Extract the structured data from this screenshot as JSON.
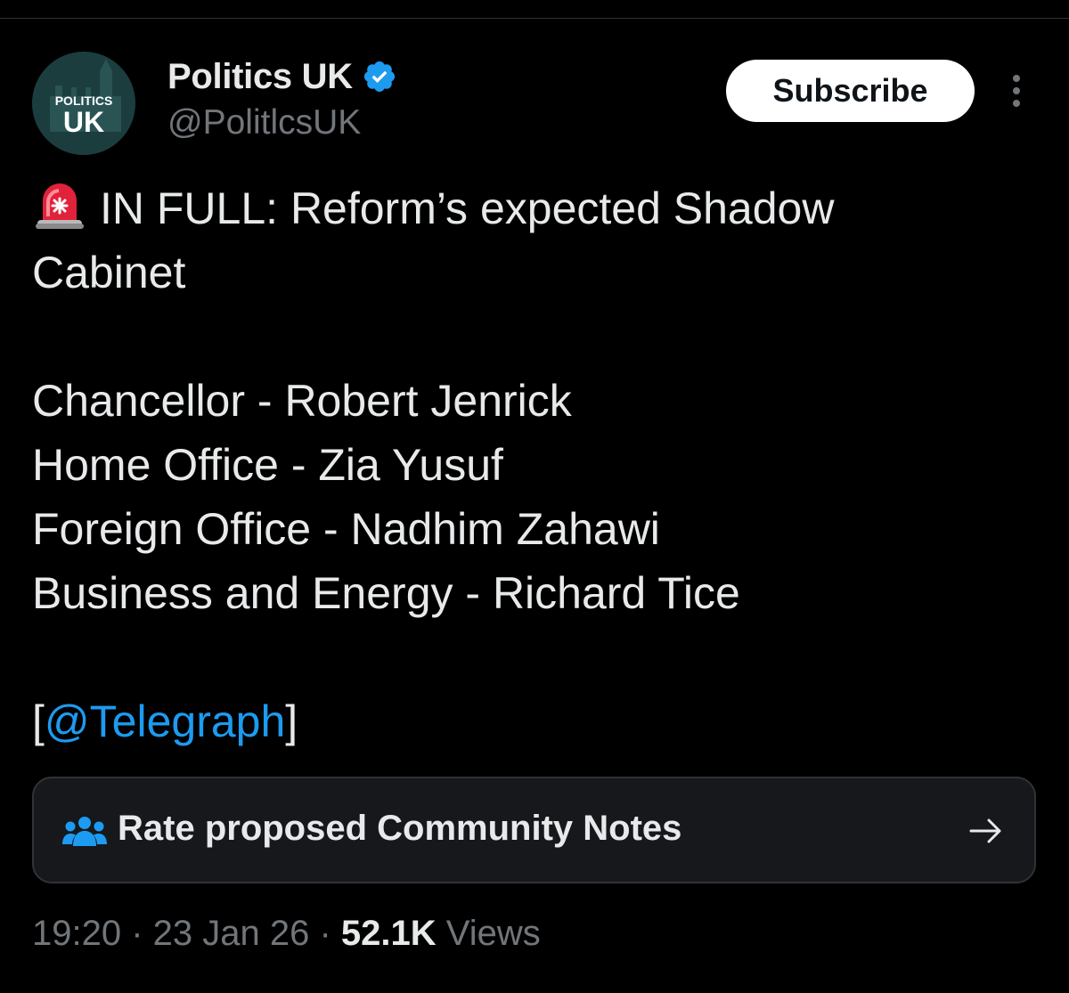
{
  "post": {
    "display_name": "Politics UK",
    "handle": "@PolitlcsUK",
    "avatar_text_top": "POLITICS",
    "avatar_text_bottom": "UK",
    "verified": true,
    "subscribe_label": "Subscribe",
    "text_lines": [
      "IN FULL: Reform’s expected Shadow",
      "Cabinet",
      "",
      "Chancellor - Robert Jenrick",
      "Home Office - Zia Yusuf",
      "Foreign Office - Nadhim Zahawi",
      "Business and Energy - Richard Tice",
      ""
    ],
    "link_prefix": "[",
    "link_text": "@Telegraph",
    "link_suffix": "]",
    "siren_icon": "police-car-light-emoji",
    "community_notes": {
      "label": "Rate proposed Community Notes",
      "icon": "people-icon",
      "arrow_icon": "arrow-right-icon"
    },
    "meta": {
      "time": "19:20",
      "separator": " · ",
      "date": "23 Jan 26",
      "views_count": "52.1K",
      "views_label": "Views"
    }
  },
  "colors": {
    "background": "#000000",
    "text": "#e7e9ea",
    "secondary_text": "#71767b",
    "link": "#1d9bf0",
    "verified_badge": "#1d9bf0",
    "notes_icon": "#1d9bf0"
  }
}
